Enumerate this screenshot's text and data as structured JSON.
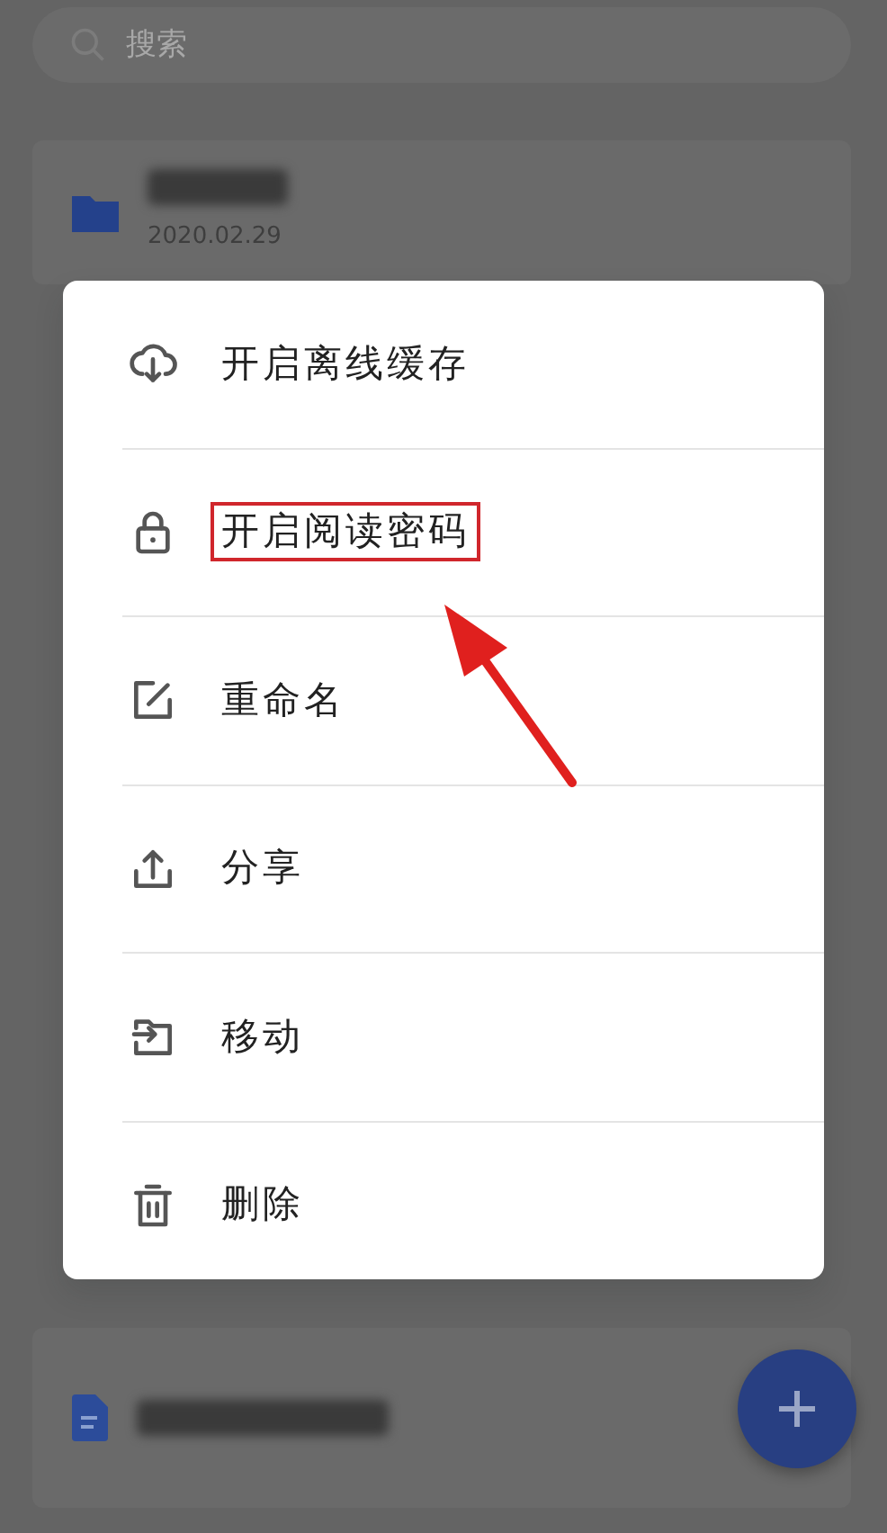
{
  "search": {
    "placeholder": "搜索"
  },
  "files": [
    {
      "kind": "folder",
      "date": "2020.02.29"
    },
    {
      "kind": "document"
    }
  ],
  "menu": [
    {
      "kind": "cloud",
      "label": "开启离线缓存",
      "highlighted": false
    },
    {
      "kind": "lock",
      "label": "开启阅读密码",
      "highlighted": true
    },
    {
      "kind": "edit",
      "label": "重命名",
      "highlighted": false
    },
    {
      "kind": "share",
      "label": "分享",
      "highlighted": false
    },
    {
      "kind": "move",
      "label": "移动",
      "highlighted": false
    },
    {
      "kind": "delete",
      "label": "删除",
      "highlighted": false
    }
  ]
}
